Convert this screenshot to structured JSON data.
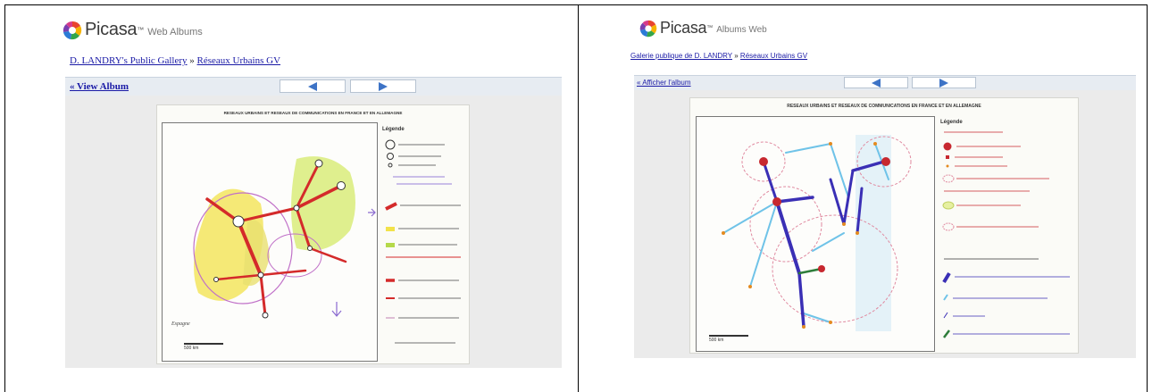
{
  "left_window": {
    "logo_text": "Picasa",
    "logo_tm": "™",
    "logo_sub": "Web Albums",
    "breadcrumb": {
      "gallery_link": "D. LANDRY's Public Gallery",
      "separator": "»",
      "album_link": "Réseaux Urbains GV"
    },
    "nav": {
      "back_label": "« View Album"
    },
    "photo": {
      "title": "RESEAUX URBAINS ET RESEAUX DE COMMUNICATIONS EN FRANCE ET EN ALLEMAGNE",
      "legend_title": "Légende",
      "scale_label": "500 km",
      "country_label": "Espagne"
    }
  },
  "right_window": {
    "logo_text": "Picasa",
    "logo_tm": "™",
    "logo_sub": "Albums Web",
    "breadcrumb": {
      "gallery_link": "Galerie publique de D. LANDRY",
      "separator": "»",
      "album_link": "Réseaux Urbains GV"
    },
    "nav": {
      "back_label": "« Afficher l'album"
    },
    "photo": {
      "title": "RESEAUX URBAINS ET RESEAUX DE COMMUNICATIONS EN FRANCE ET EN ALLEMAGNE",
      "legend_title": "Légende",
      "scale_label": "500 km"
    }
  },
  "colors": {
    "link": "#1a1aa6",
    "nav_bg": "#e7ecf2",
    "nav_arrow": "#3d73c6",
    "stage_bg": "#ebebeb",
    "route_red": "#d42a2a",
    "route_blue": "#3a2fb5",
    "route_cyan": "#6fc3e8"
  },
  "icons": {
    "logo": "picasa-pinwheel-icon",
    "prev": "triangle-left-icon",
    "next": "triangle-right-icon"
  }
}
